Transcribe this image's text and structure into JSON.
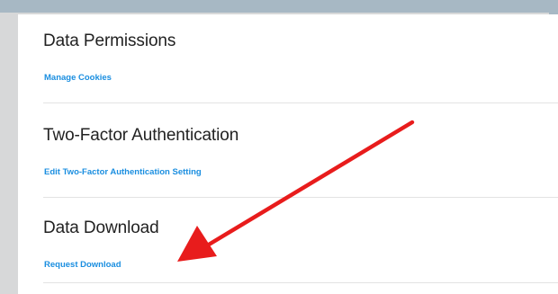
{
  "sections": [
    {
      "title": "Data Permissions",
      "link": "Manage Cookies"
    },
    {
      "title": "Two-Factor Authentication",
      "link": "Edit Two-Factor Authentication Setting"
    },
    {
      "title": "Data Download",
      "link": "Request Download"
    }
  ],
  "annotation": {
    "arrow_color": "#e81c1c"
  },
  "colors": {
    "link": "#1a8ee0",
    "title": "#222222",
    "divider": "#e3e3e3",
    "backdrop": "#a7b8c4",
    "frame": "#d7d8d9"
  }
}
